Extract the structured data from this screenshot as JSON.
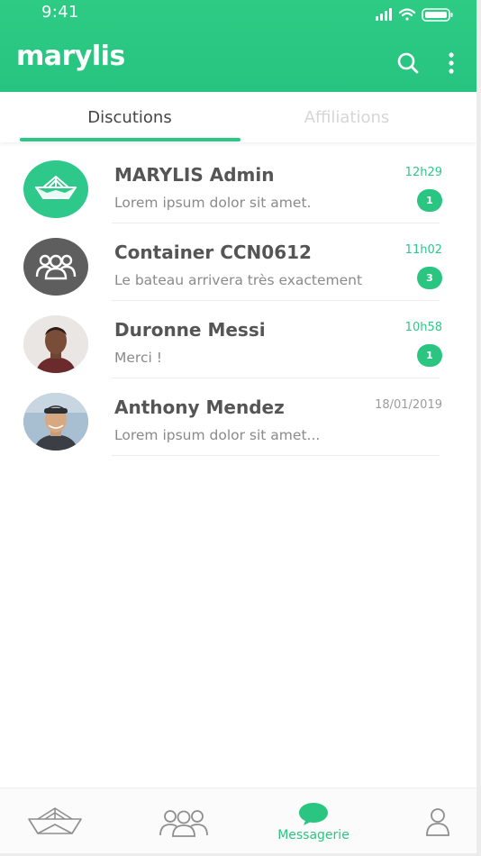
{
  "status_bar": {
    "time": "9:41"
  },
  "header": {
    "brand": "marylis",
    "search_icon": "search-icon",
    "more_icon": "more-vertical-icon",
    "background": "#2ecb85"
  },
  "tabs": [
    {
      "label": "Discutions",
      "active": true
    },
    {
      "label": "Affiliations",
      "active": false
    }
  ],
  "conversations": [
    {
      "name": "MARYLIS Admin",
      "preview": "Lorem ipsum dolor sit amet.",
      "time": "12h29",
      "unread": "1",
      "avatar": "boat-logo-icon"
    },
    {
      "name": "Container CCN0612",
      "preview": "Le bateau arrivera très exactement",
      "time": "11h02",
      "unread": "3",
      "avatar": "group-icon"
    },
    {
      "name": "Duronne Messi",
      "preview": "Merci !",
      "time": "10h58",
      "unread": "1",
      "avatar": "user-photo"
    },
    {
      "name": "Anthony Mendez",
      "preview": "Lorem ipsum dolor sit amet...",
      "time": "18/01/2019",
      "unread": "",
      "avatar": "user-photo"
    }
  ],
  "bottom_nav": {
    "items": [
      {
        "icon": "boat-icon",
        "label": ""
      },
      {
        "icon": "groups-icon",
        "label": ""
      },
      {
        "icon": "chat-bubble-icon",
        "label": "Messagerie",
        "active": true
      },
      {
        "icon": "profile-icon",
        "label": ""
      }
    ]
  },
  "colors": {
    "accent": "#29c885",
    "badge": "#2ac581",
    "inactive_tab": "#d6d6d6"
  }
}
